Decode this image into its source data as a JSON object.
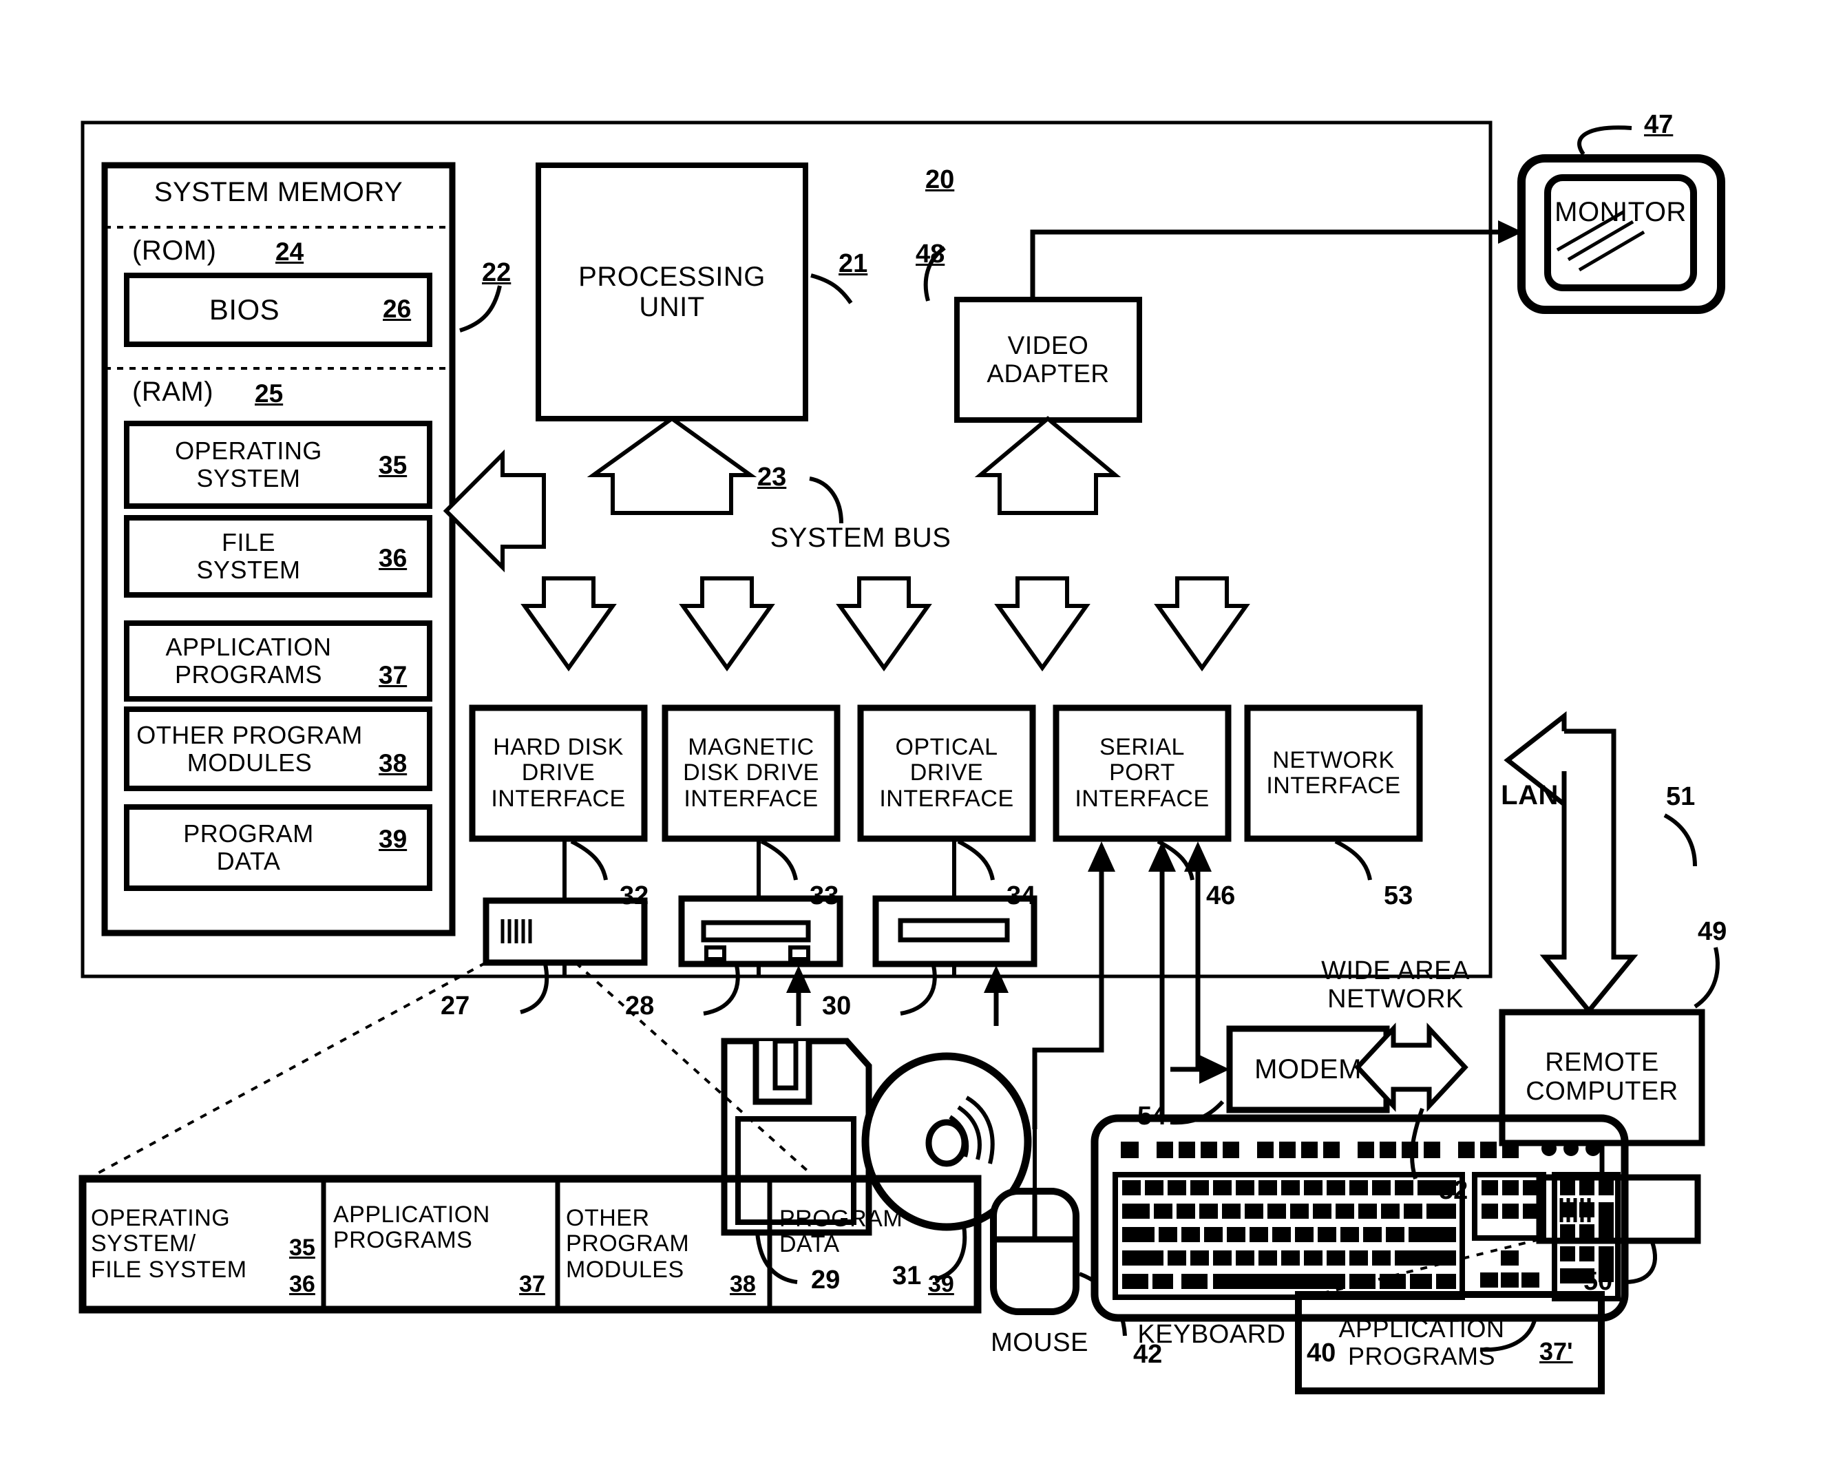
{
  "figure": {
    "type": "patent-block-diagram",
    "system_ref": "20"
  },
  "system_memory": {
    "title": "SYSTEM MEMORY",
    "rom_label": "(ROM)",
    "rom_ref": "24",
    "bios_label": "BIOS",
    "bios_ref": "26",
    "ram_label": "(RAM)",
    "ram_ref": "25",
    "memory_ref": "22",
    "items": [
      {
        "line1": "OPERATING",
        "line2": "SYSTEM",
        "ref": "35"
      },
      {
        "line1": "FILE",
        "line2": "SYSTEM",
        "ref": "36"
      },
      {
        "line1": "APPLICATION",
        "line2": "PROGRAMS",
        "ref": "37"
      },
      {
        "line1": "OTHER PROGRAM",
        "line2": "MODULES",
        "ref": "38"
      },
      {
        "line1": "PROGRAM",
        "line2": "DATA",
        "ref": "39"
      }
    ]
  },
  "processing_unit": {
    "line1": "PROCESSING",
    "line2": "UNIT",
    "ref": "21"
  },
  "video_adapter": {
    "line1": "VIDEO",
    "line2": "ADAPTER",
    "ref": "48"
  },
  "monitor": {
    "label": "MONITOR",
    "ref": "47"
  },
  "system_bus": {
    "label": "SYSTEM BUS",
    "ref": "23"
  },
  "interfaces": [
    {
      "line1": "HARD DISK",
      "line2": "DRIVE",
      "line3": "INTERFACE",
      "ref": "32"
    },
    {
      "line1": "MAGNETIC",
      "line2": "DISK DRIVE",
      "line3": "INTERFACE",
      "ref": "33"
    },
    {
      "line1": "OPTICAL",
      "line2": "DRIVE",
      "line3": "INTERFACE",
      "ref": "34"
    },
    {
      "line1": "SERIAL",
      "line2": "PORT",
      "line3": "INTERFACE",
      "ref": "46"
    },
    {
      "line1": "NETWORK",
      "line2": "INTERFACE",
      "line3": "",
      "ref": "53"
    }
  ],
  "drives": {
    "hard_disk_ref": "27",
    "magnetic_drive_ref": "28",
    "floppy_media_ref": "29",
    "optical_drive_ref": "30",
    "optical_media_ref": "31"
  },
  "storage_contents": [
    {
      "line1": "OPERATING",
      "line2": "SYSTEM/",
      "ref1": "35",
      "line3": "FILE SYSTEM",
      "ref2": "36"
    },
    {
      "line1": "APPLICATION",
      "line2": "PROGRAMS",
      "ref1": "37"
    },
    {
      "line1": "OTHER",
      "line2": "PROGRAM",
      "line3": "MODULES",
      "ref1": "38"
    },
    {
      "line1": "PROGRAM",
      "line2": "DATA",
      "ref1": "39"
    }
  ],
  "peripherals": {
    "mouse_label": "MOUSE",
    "mouse_ref": "42",
    "keyboard_label": "KEYBOARD",
    "keyboard_ref": "40"
  },
  "network": {
    "lan_label": "LAN",
    "lan_ref": "51",
    "wan_line1": "WIDE AREA",
    "wan_line2": "NETWORK",
    "wan_ref": "52",
    "modem_label": "MODEM",
    "modem_ref": "54",
    "remote_line1": "REMOTE",
    "remote_line2": "COMPUTER",
    "remote_ref": "49",
    "remote_storage_ref": "50",
    "remote_apps_line1": "APPLICATION",
    "remote_apps_line2": "PROGRAMS",
    "remote_apps_ref": "37'"
  },
  "colors": {
    "ink": "#000000",
    "paper": "#ffffff"
  }
}
